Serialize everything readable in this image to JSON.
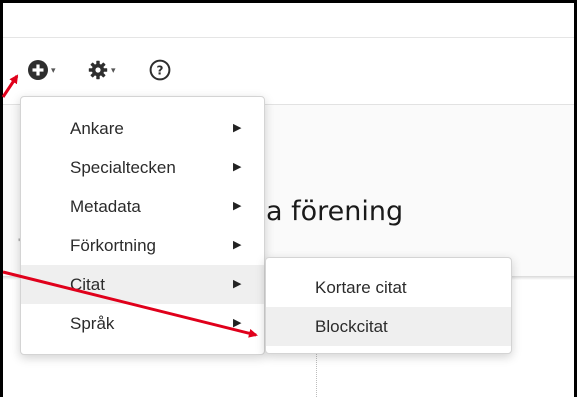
{
  "toolbar": {
    "add_caret": "▾",
    "settings_caret": "▾",
    "help_glyph": "?"
  },
  "heading_fragment": "a förening",
  "heading_tick": "'",
  "menu": {
    "items": [
      {
        "label": "Ankare",
        "arrow": "▶"
      },
      {
        "label": "Specialtecken",
        "arrow": "▶"
      },
      {
        "label": "Metadata",
        "arrow": "▶"
      },
      {
        "label": "Förkortning",
        "arrow": "▶"
      },
      {
        "label": "Citat",
        "arrow": "▶"
      },
      {
        "label": "Språk",
        "arrow": "▶"
      }
    ],
    "active_item": "Citat"
  },
  "submenu": {
    "items": [
      {
        "label": "Kortare citat"
      },
      {
        "label": "Blockcitat"
      }
    ],
    "highlighted_item": "Blockcitat"
  },
  "annotation_arrow_color": "#e0001b",
  "icons": {
    "add": "plus-circle-icon",
    "settings": "gear-icon",
    "help": "question-circle-icon",
    "submenu_arrow": "triangle-right-icon"
  }
}
